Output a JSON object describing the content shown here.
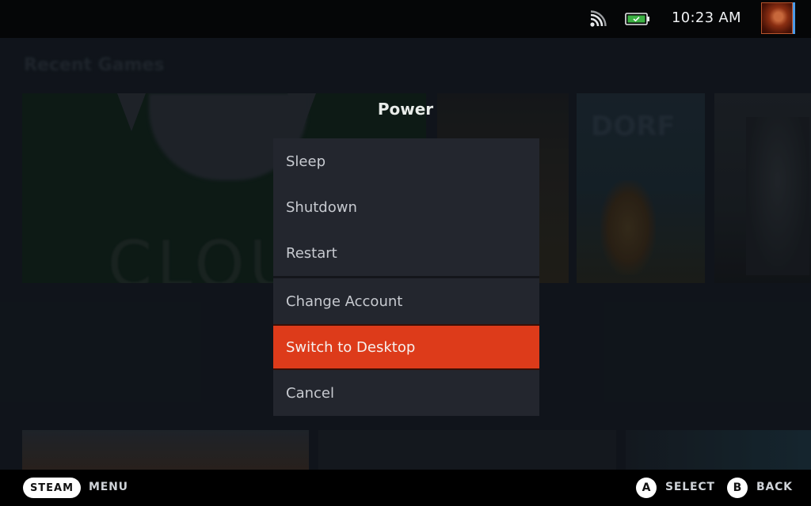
{
  "status_bar": {
    "wifi_icon": "wifi-icon",
    "battery_icon": "battery-charged-icon",
    "battery_color": "#3cb043",
    "time": "10:23 AM",
    "avatar_icon": "user-avatar"
  },
  "library": {
    "section_title": "Recent Games",
    "tiles": [
      {
        "name": "Xbox Cloud Gaming",
        "visible_text": "CLOU"
      },
      {
        "name": "game-tile-2"
      },
      {
        "name": "Dorfromantik",
        "visible_text": "DORF"
      },
      {
        "name": "game-tile-4"
      }
    ]
  },
  "power_menu": {
    "title": "Power",
    "groups": [
      [
        {
          "label": "Sleep"
        },
        {
          "label": "Shutdown"
        },
        {
          "label": "Restart"
        }
      ],
      [
        {
          "label": "Change Account"
        }
      ],
      [
        {
          "label": "Switch to Desktop",
          "focused": true
        }
      ],
      [
        {
          "label": "Cancel"
        }
      ]
    ],
    "focus_color": "#dd3b1a"
  },
  "footer": {
    "steam_button": "STEAM",
    "steam_action": "MENU",
    "a_button": "A",
    "a_action": "SELECT",
    "b_button": "B",
    "b_action": "BACK"
  }
}
